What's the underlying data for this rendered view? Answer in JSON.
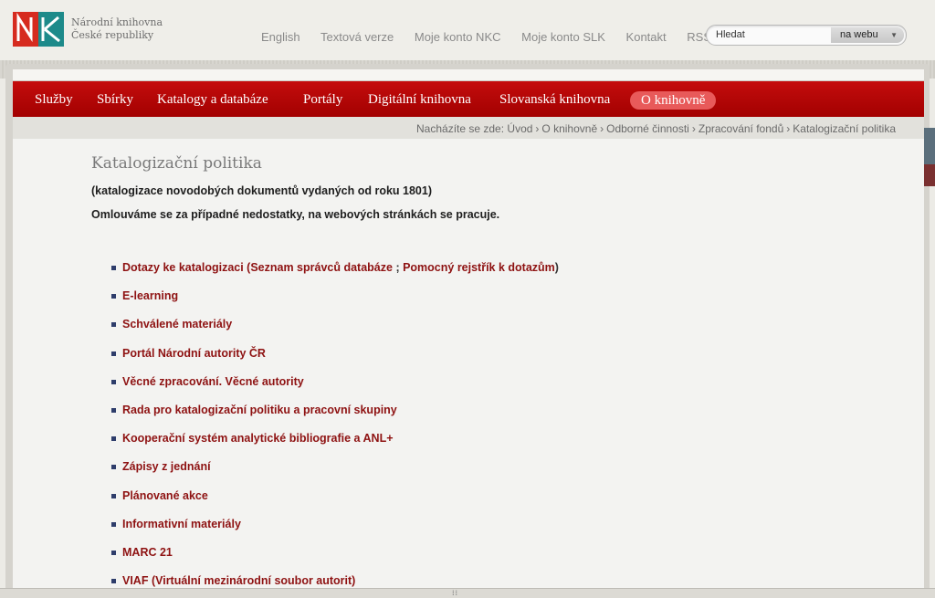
{
  "header": {
    "logo_letters": "NK",
    "library_name_line1": "Národní knihovna",
    "library_name_line2": "České republiky",
    "top_links": [
      "English",
      "Textová verze",
      "Moje konto NKC",
      "Moje konto SLK",
      "Kontakt",
      "RSS"
    ],
    "search": {
      "placeholder": "Hledat",
      "scope": "na webu"
    }
  },
  "nav": {
    "items": [
      {
        "label": "Služby",
        "active": false
      },
      {
        "label": "Sbírky",
        "active": false
      },
      {
        "label": "Katalogy a databáze",
        "active": false
      },
      {
        "label": "Portály",
        "active": false
      },
      {
        "label": "Digitální knihovna",
        "active": false
      },
      {
        "label": "Slovanská knihovna",
        "active": false
      },
      {
        "label": "O knihovně",
        "active": true
      }
    ]
  },
  "breadcrumb": {
    "prefix": "Nacházíte se zde:",
    "items": [
      "Úvod",
      "O knihovně",
      "Odborné činnosti",
      "Zpracování fondů",
      "Katalogizační politika"
    ]
  },
  "content": {
    "title": "Katalogizační politika",
    "subtitle": "(katalogizace novodobých dokumentů vydaných od roku 1801)",
    "notice": "Omlouváme se za případné nedostatky, na webových stránkách se pracuje.",
    "first_link": {
      "label": "Dotazy ke katalogizaci",
      "open": " (",
      "sub1": "Seznam správců databáze",
      "sep": " ; ",
      "sub2": "Pomocný rejstřík k dotazům",
      "close": ")"
    },
    "links": [
      "E-learning",
      "Schválené materiály",
      "Portál Národní autority ČR",
      "Věcné zpracování. Věcné autority",
      "Rada pro katalogizační politiku a pracovní skupiny",
      "Kooperační systém analytické bibliografie a ANL+",
      "Zápisy z jednání",
      "Plánované akce",
      "Informativní materiály",
      "MARC 21",
      "VIAF (Virtuální mezinárodní soubor autorit)"
    ]
  },
  "colors": {
    "nav_red": "#b10606",
    "link_red": "#8e1212",
    "active_pill": "#e85a5a",
    "logo_red": "#d62b1f",
    "logo_teal": "#1d8a8a"
  }
}
